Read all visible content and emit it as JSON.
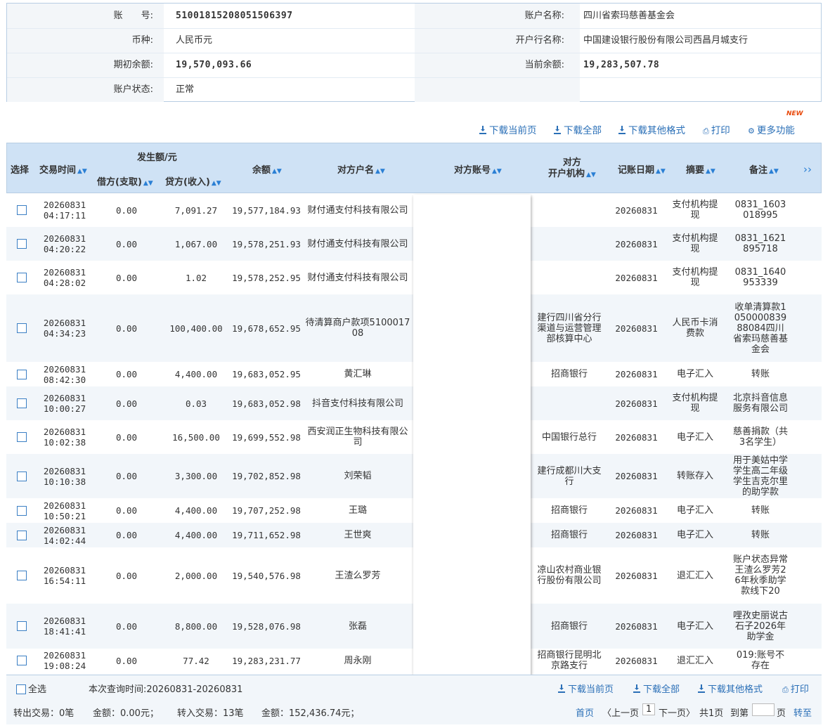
{
  "account": {
    "no_label": "账　　号:",
    "no_value": "51001815208051506397",
    "name_label": "账户名称:",
    "name_value": "四川省索玛慈善基金会",
    "currency_label": "币种:",
    "currency_value": "人民币元",
    "bank_label": "开户行名称:",
    "bank_value": "中国建设银行股份有限公司西昌月城支行",
    "opening_label": "期初余额:",
    "opening_value": "19,570,093.66",
    "current_label": "当前余额:",
    "current_value": "19,283,507.78",
    "status_label": "账户状态:",
    "status_value": "正常"
  },
  "toolbar": {
    "new_badge": "NEW",
    "download_page": "下载当前页",
    "download_all": "下载全部",
    "download_other": "下载其他格式",
    "print": "打印",
    "more": "更多功能"
  },
  "header": {
    "select": "选择",
    "time": "交易时间",
    "amount_group": "发生额/元",
    "debit": "借方(支取)",
    "credit": "贷方(收入)",
    "balance": "余额",
    "counterparty_name": "对方户名",
    "counterparty_account": "对方账号",
    "counterparty_bank_1": "对方",
    "counterparty_bank_2": "开户机构",
    "post_date": "记账日期",
    "summary": "摘要",
    "remark": "备注",
    "more_arrow": "››"
  },
  "rows": [
    {
      "date": "20260831",
      "time": "04:17:11",
      "debit": "0.00",
      "credit": "7,091.27",
      "balance": "19,577,184.93",
      "name": "财付通支付科技有限公司",
      "bank": "",
      "post": "20260831",
      "summary": "支付机构提现",
      "remark": "0831_1603018995"
    },
    {
      "date": "20260831",
      "time": "04:20:22",
      "debit": "0.00",
      "credit": "1,067.00",
      "balance": "19,578,251.93",
      "name": "财付通支付科技有限公司",
      "bank": "",
      "post": "20260831",
      "summary": "支付机构提现",
      "remark": "0831_1621895718"
    },
    {
      "date": "20260831",
      "time": "04:28:02",
      "debit": "0.00",
      "credit": "1.02",
      "balance": "19,578,252.95",
      "name": "财付通支付科技有限公司",
      "bank": "",
      "post": "20260831",
      "summary": "支付机构提现",
      "remark": "0831_1640953339"
    },
    {
      "date": "20260831",
      "time": "04:34:23",
      "debit": "0.00",
      "credit": "100,400.00",
      "balance": "19,678,652.95",
      "name": "待清算商户款项510001708",
      "bank": "建行四川省分行渠道与运营管理部核算中心",
      "post": "20260831",
      "summary": "人民币卡消费款",
      "remark": "收单清算款105000083988084四川省索玛慈善基金会"
    },
    {
      "date": "20260831",
      "time": "08:42:30",
      "debit": "0.00",
      "credit": "4,400.00",
      "balance": "19,683,052.95",
      "name": "黄汇琳",
      "bank": "招商银行",
      "post": "20260831",
      "summary": "电子汇入",
      "remark": "转账"
    },
    {
      "date": "20260831",
      "time": "10:00:27",
      "debit": "0.00",
      "credit": "0.03",
      "balance": "19,683,052.98",
      "name": "抖音支付科技有限公司",
      "bank": "",
      "post": "20260831",
      "summary": "支付机构提现",
      "remark": "北京抖音信息服务有限公司"
    },
    {
      "date": "20260831",
      "time": "10:02:38",
      "debit": "0.00",
      "credit": "16,500.00",
      "balance": "19,699,552.98",
      "name": "西安润正生物科技有限公司",
      "bank": "中国银行总行",
      "post": "20260831",
      "summary": "电子汇入",
      "remark": "慈善捐款（共3名学生）"
    },
    {
      "date": "20260831",
      "time": "10:10:38",
      "debit": "0.00",
      "credit": "3,300.00",
      "balance": "19,702,852.98",
      "name": "刘荣韬",
      "bank": "建行成都川大支行",
      "post": "20260831",
      "summary": "转账存入",
      "remark": "用于美姑中学学生高二年级学生吉克尔里的助学款"
    },
    {
      "date": "20260831",
      "time": "10:50:21",
      "debit": "0.00",
      "credit": "4,400.00",
      "balance": "19,707,252.98",
      "name": "王璐",
      "bank": "招商银行",
      "post": "20260831",
      "summary": "电子汇入",
      "remark": "转账"
    },
    {
      "date": "20260831",
      "time": "14:02:44",
      "debit": "0.00",
      "credit": "4,400.00",
      "balance": "19,711,652.98",
      "name": "王世爽",
      "bank": "招商银行",
      "post": "20260831",
      "summary": "电子汇入",
      "remark": "转账"
    },
    {
      "date": "20260831",
      "time": "16:54:11",
      "debit": "0.00",
      "credit": "2,000.00",
      "balance": "19,540,576.98",
      "name": "王渣么罗芳",
      "bank": "凉山农村商业银行股份有限公司",
      "post": "20260831",
      "summary": "退汇汇入",
      "remark": "账户状态异常王渣么罗芳26年秋季助学款线下20"
    },
    {
      "date": "20260831",
      "time": "18:41:41",
      "debit": "0.00",
      "credit": "8,800.00",
      "balance": "19,528,076.98",
      "name": "张磊",
      "bank": "招商银行",
      "post": "20260831",
      "summary": "电子汇入",
      "remark": "哩孜史丽说古石子2026年助学金"
    },
    {
      "date": "20260831",
      "time": "19:08:24",
      "debit": "0.00",
      "credit": "77.42",
      "balance": "19,283,231.77",
      "name": "周永刚",
      "bank": "招商银行昆明北京路支行",
      "post": "20260831",
      "summary": "退汇汇入",
      "remark": "019:账号不存在"
    }
  ],
  "footer": {
    "select_all": "全选",
    "query_time": "本次查询时间:20260831-20260831",
    "download_page": "下载当前页",
    "download_all": "下载全部",
    "download_other": "下载其他格式",
    "print": "打印",
    "out_tx": "转出交易：0笔",
    "out_amount": "金额：0.00元；",
    "in_tx": "转入交易：13笔",
    "in_amount": "金额：152,436.74元；",
    "first": "首页",
    "prev": "〈上一页",
    "page": "1",
    "next": "下一页〉",
    "total": "共1页",
    "goto": "到第",
    "page_unit": "页",
    "go": "转至"
  }
}
